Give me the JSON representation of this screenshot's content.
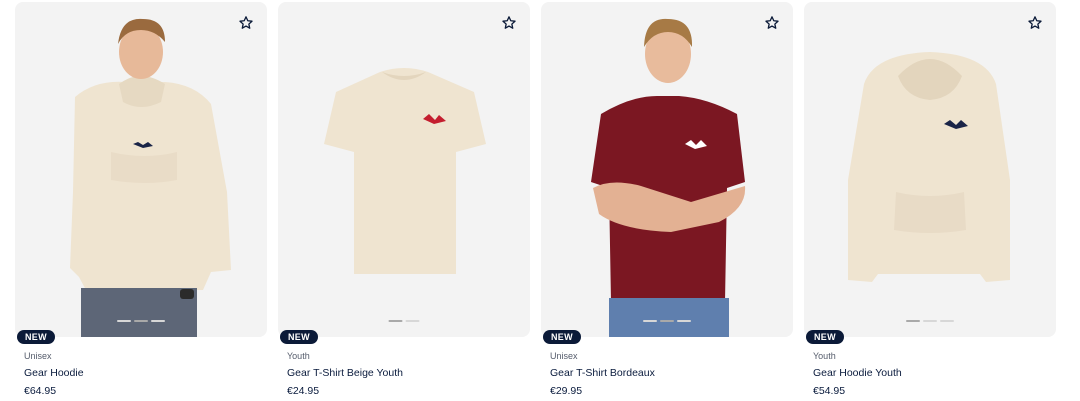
{
  "products": [
    {
      "badge": "NEW",
      "category": "Unisex",
      "name": "Gear Hoodie",
      "price": "€64.95",
      "image": "man-wearing-beige-hoodie",
      "slide_count": 3,
      "active_slide": 1
    },
    {
      "badge": "NEW",
      "category": "Youth",
      "name": "Gear T-Shirt Beige Youth",
      "price": "€24.95",
      "image": "beige-tshirt",
      "slide_count": 2,
      "active_slide": 0
    },
    {
      "badge": "NEW",
      "category": "Unisex",
      "name": "Gear T-Shirt Bordeaux",
      "price": "€29.95",
      "image": "man-wearing-bordeaux-tshirt",
      "slide_count": 3,
      "active_slide": 1
    },
    {
      "badge": "NEW",
      "category": "Youth",
      "name": "Gear Hoodie Youth",
      "price": "€54.95",
      "image": "beige-youth-hoodie",
      "slide_count": 3,
      "active_slide": 0
    }
  ],
  "icons": {
    "favorite": "star-outline-icon"
  },
  "colors": {
    "badge_bg": "#0b1a38",
    "text": "#0a1b3d",
    "card_bg": "#f3f3f3",
    "beige": "#efe4d0",
    "bordeaux": "#7b1722"
  }
}
